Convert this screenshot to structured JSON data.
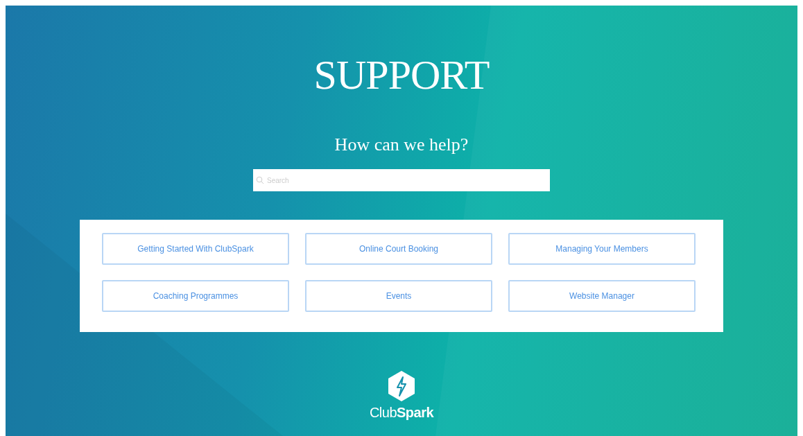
{
  "hero": {
    "title": "SUPPORT",
    "subtitle": "How can we help?"
  },
  "search": {
    "placeholder": "Search"
  },
  "topics": [
    {
      "label": "Getting Started With ClubSpark"
    },
    {
      "label": "Online Court Booking"
    },
    {
      "label": "Managing Your Members"
    },
    {
      "label": "Coaching Programmes"
    },
    {
      "label": "Events"
    },
    {
      "label": "Website Manager"
    }
  ],
  "footer": {
    "brand_regular": "Club",
    "brand_bold": "Spark"
  }
}
